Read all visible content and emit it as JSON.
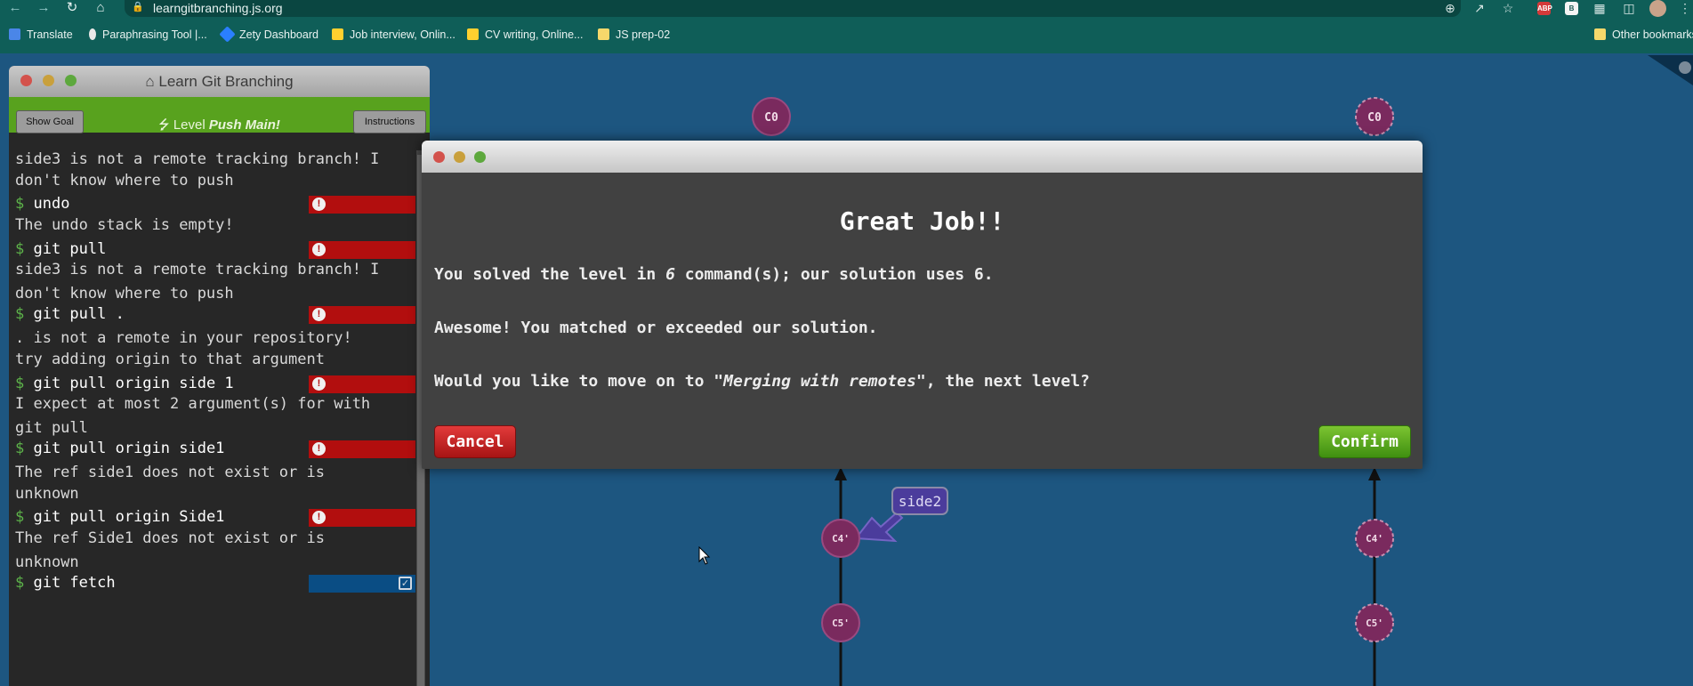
{
  "browser": {
    "url": "learngitbranching.js.org",
    "bookmarks": [
      {
        "label": "Translate",
        "icon": "translate-icon",
        "color": "#4a86e8"
      },
      {
        "label": "Paraphrasing Tool |...",
        "icon": "quill-icon",
        "color": "#e9e9e9"
      },
      {
        "label": "Zety Dashboard",
        "icon": "zety-icon",
        "color": "#2a7fff"
      },
      {
        "label": "Job interview, Onlin...",
        "icon": "miro-icon",
        "color": "#ffd02f"
      },
      {
        "label": "CV writing, Online...",
        "icon": "miro-icon",
        "color": "#ffd02f"
      },
      {
        "label": "JS prep-02",
        "icon": "sticky-note-icon",
        "color": "#f6d86b"
      }
    ],
    "other_bookmarks": "Other bookmarks",
    "ext_abp": "ABP",
    "ext_b": "B"
  },
  "terminal": {
    "title": "Learn Git Branching",
    "show_goal": "Show Goal",
    "instructions": "Instructions",
    "level_prefix": "Level",
    "level_name": "Push Main!",
    "lines": [
      {
        "kind": "out",
        "text": "side3 is not a remote tracking branch! I"
      },
      {
        "kind": "out",
        "text": "don't know where to push"
      },
      {
        "kind": "cmd",
        "text": "undo",
        "status": "error"
      },
      {
        "kind": "out",
        "text": "The undo stack is empty!"
      },
      {
        "kind": "cmd",
        "text": "git pull",
        "status": "error"
      },
      {
        "kind": "out",
        "text": "side3 is not a remote tracking branch! I"
      },
      {
        "kind": "out",
        "text": "don't know where to push"
      },
      {
        "kind": "cmd",
        "text": "git pull .",
        "status": "error"
      },
      {
        "kind": "out",
        "text": ". is not a remote in your repository!"
      },
      {
        "kind": "out",
        "text": "try adding origin to that argument"
      },
      {
        "kind": "cmd",
        "text": "git pull origin side 1",
        "status": "error"
      },
      {
        "kind": "out",
        "text": "I expect at most 2 argument(s) for with"
      },
      {
        "kind": "out",
        "text": "git pull"
      },
      {
        "kind": "cmd",
        "text": "git pull origin side1",
        "status": "error"
      },
      {
        "kind": "out",
        "text": "The ref side1 does not exist or is"
      },
      {
        "kind": "out",
        "text": "unknown"
      },
      {
        "kind": "cmd",
        "text": "git pull origin Side1",
        "status": "error"
      },
      {
        "kind": "out",
        "text": "The ref Side1 does not exist or is"
      },
      {
        "kind": "out",
        "text": "unknown"
      },
      {
        "kind": "cmd",
        "text": "git fetch",
        "status": "ok"
      }
    ]
  },
  "graph": {
    "nodes": [
      {
        "label": "C0",
        "dashed": false
      },
      {
        "label": "C0",
        "dashed": true
      },
      {
        "label": "C4'",
        "dashed": false
      },
      {
        "label": "C4'",
        "dashed": true
      },
      {
        "label": "C5'",
        "dashed": false
      },
      {
        "label": "C5'",
        "dashed": true
      }
    ],
    "branch_label": "side2",
    "colors": {
      "commit": "#7a2a5e",
      "branch": "#4b3c9c",
      "canvas": "#1d5680"
    }
  },
  "modal": {
    "title": "Great Job!!",
    "line1_a": "You solved the level in ",
    "line1_num": "6",
    "line1_b": " command(s); our solution uses 6.",
    "line2": "Awesome! You matched or exceeded our solution.",
    "line3_a": "Would you like to move on to ",
    "line3_level": "\"Merging with remotes\"",
    "line3_b": ", the next level?",
    "cancel": "Cancel",
    "confirm": "Confirm"
  }
}
